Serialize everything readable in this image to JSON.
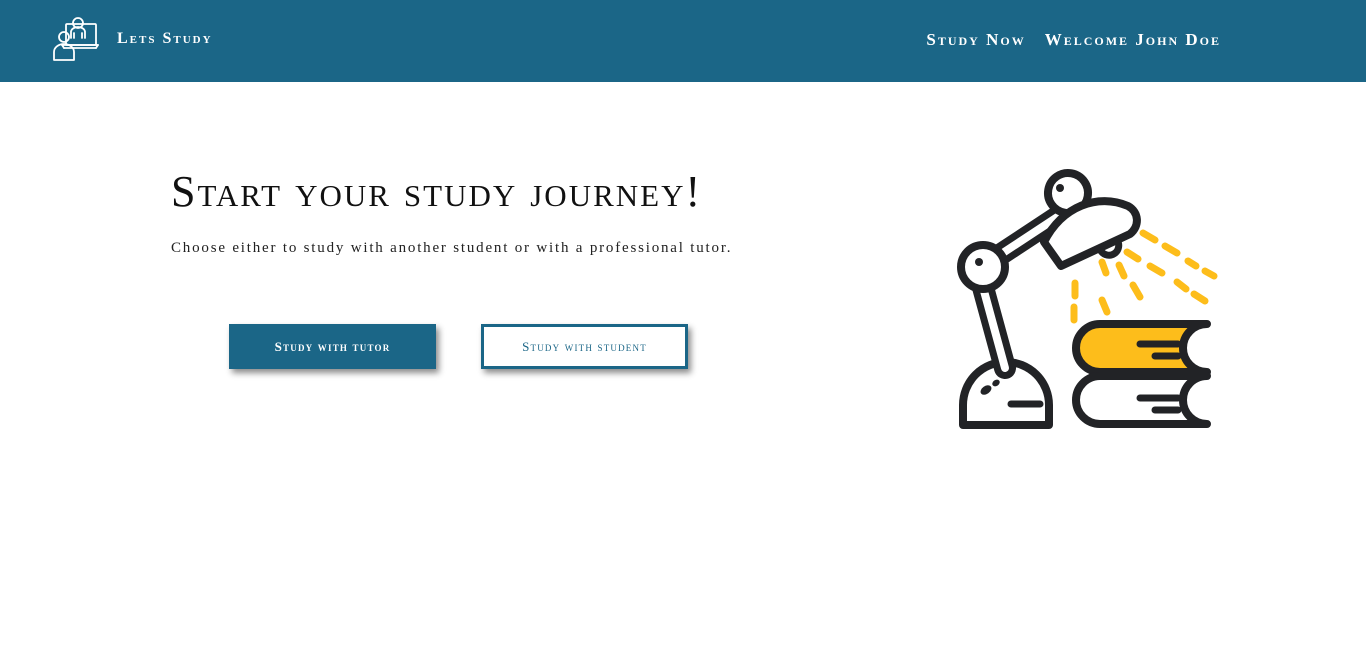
{
  "navbar": {
    "brand_name": "Lets Study",
    "brand_logo_icon": "online-tutor-icon",
    "links": [
      {
        "label": "Study Now"
      },
      {
        "label": "Welcome John Doe"
      }
    ],
    "background_color": "#1b6687"
  },
  "hero": {
    "title": "Start your study journey!",
    "subtitle": "Choose either to study with another student or with a professional tutor.",
    "buttons": {
      "tutor_label": "Study with tutor",
      "student_label": "Study with student"
    },
    "illustration_icon": "desk-lamp-books-icon",
    "accent_color": "#fdbd1b"
  }
}
